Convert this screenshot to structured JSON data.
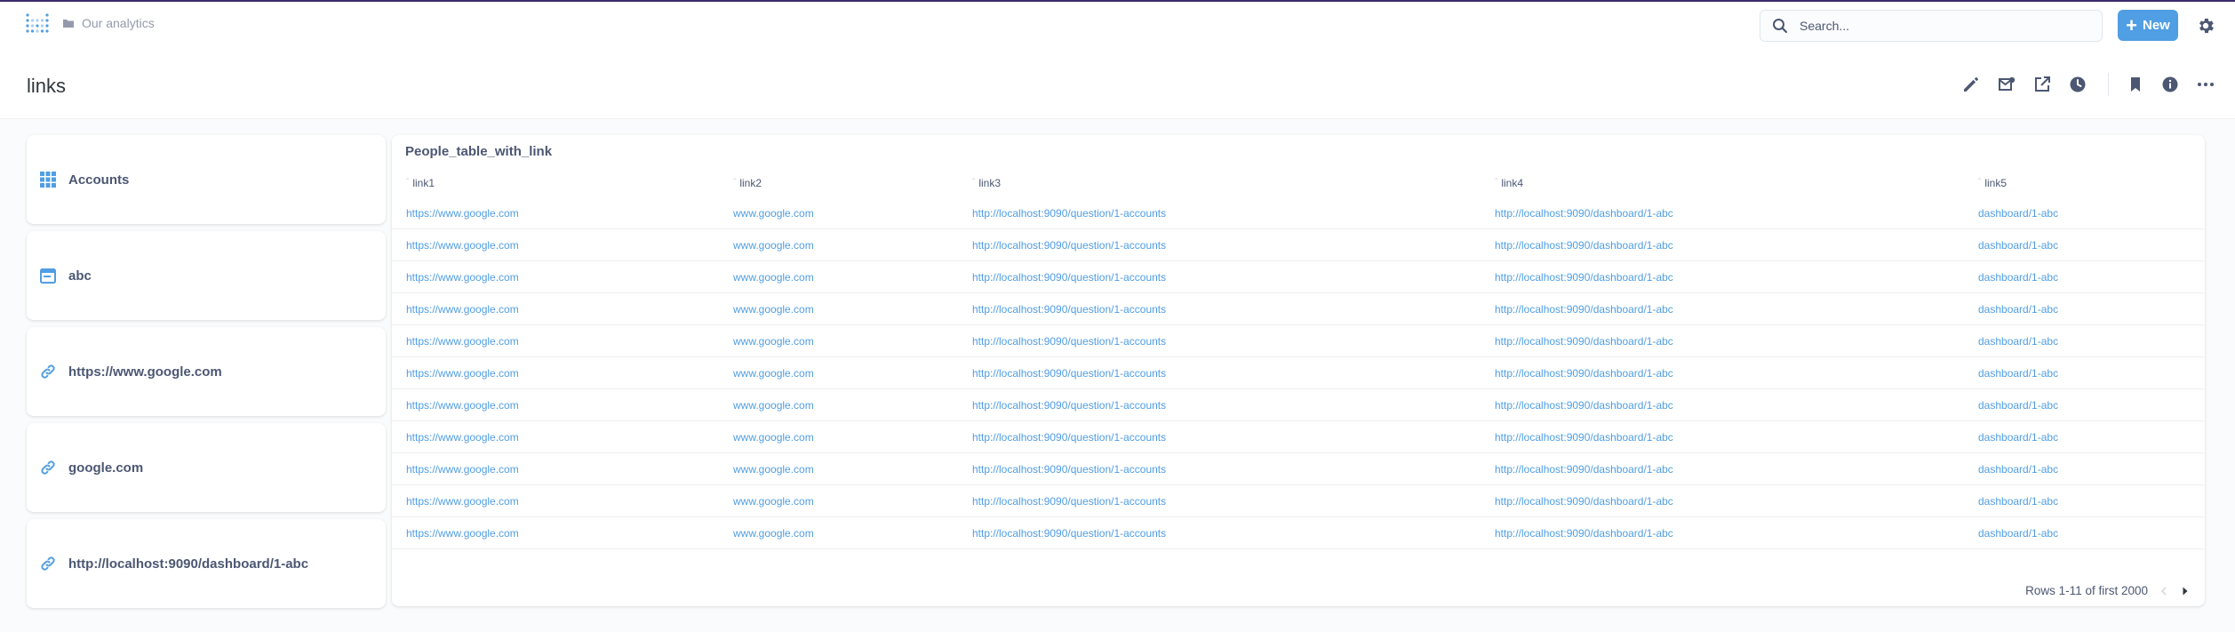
{
  "nav": {
    "breadcrumb": "Our analytics",
    "search_placeholder": "Search...",
    "new_label": "New"
  },
  "page": {
    "title": "links"
  },
  "cards": [
    {
      "label": "Accounts",
      "icon": "grid-icon"
    },
    {
      "label": "abc",
      "icon": "calendar-icon"
    },
    {
      "label": "https://www.google.com",
      "icon": "link-icon"
    },
    {
      "label": "google.com",
      "icon": "link-icon"
    },
    {
      "label": "http://localhost:9090/dashboard/1-abc",
      "icon": "link-icon"
    }
  ],
  "table": {
    "title": "People_table_with_link",
    "columns": [
      "link1",
      "link2",
      "link3",
      "link4",
      "link5"
    ],
    "rows": [
      [
        "https://www.google.com",
        "www.google.com",
        "http://localhost:9090/question/1-accounts",
        "http://localhost:9090/dashboard/1-abc",
        "dashboard/1-abc"
      ],
      [
        "https://www.google.com",
        "www.google.com",
        "http://localhost:9090/question/1-accounts",
        "http://localhost:9090/dashboard/1-abc",
        "dashboard/1-abc"
      ],
      [
        "https://www.google.com",
        "www.google.com",
        "http://localhost:9090/question/1-accounts",
        "http://localhost:9090/dashboard/1-abc",
        "dashboard/1-abc"
      ],
      [
        "https://www.google.com",
        "www.google.com",
        "http://localhost:9090/question/1-accounts",
        "http://localhost:9090/dashboard/1-abc",
        "dashboard/1-abc"
      ],
      [
        "https://www.google.com",
        "www.google.com",
        "http://localhost:9090/question/1-accounts",
        "http://localhost:9090/dashboard/1-abc",
        "dashboard/1-abc"
      ],
      [
        "https://www.google.com",
        "www.google.com",
        "http://localhost:9090/question/1-accounts",
        "http://localhost:9090/dashboard/1-abc",
        "dashboard/1-abc"
      ],
      [
        "https://www.google.com",
        "www.google.com",
        "http://localhost:9090/question/1-accounts",
        "http://localhost:9090/dashboard/1-abc",
        "dashboard/1-abc"
      ],
      [
        "https://www.google.com",
        "www.google.com",
        "http://localhost:9090/question/1-accounts",
        "http://localhost:9090/dashboard/1-abc",
        "dashboard/1-abc"
      ],
      [
        "https://www.google.com",
        "www.google.com",
        "http://localhost:9090/question/1-accounts",
        "http://localhost:9090/dashboard/1-abc",
        "dashboard/1-abc"
      ],
      [
        "https://www.google.com",
        "www.google.com",
        "http://localhost:9090/question/1-accounts",
        "http://localhost:9090/dashboard/1-abc",
        "dashboard/1-abc"
      ],
      [
        "https://www.google.com",
        "www.google.com",
        "http://localhost:9090/question/1-accounts",
        "http://localhost:9090/dashboard/1-abc",
        "dashboard/1-abc"
      ]
    ],
    "pagination": "Rows 1-11 of first 2000"
  },
  "colors": {
    "brand": "#509ee3",
    "text": "#4c5773",
    "background": "#f9fbfc"
  }
}
